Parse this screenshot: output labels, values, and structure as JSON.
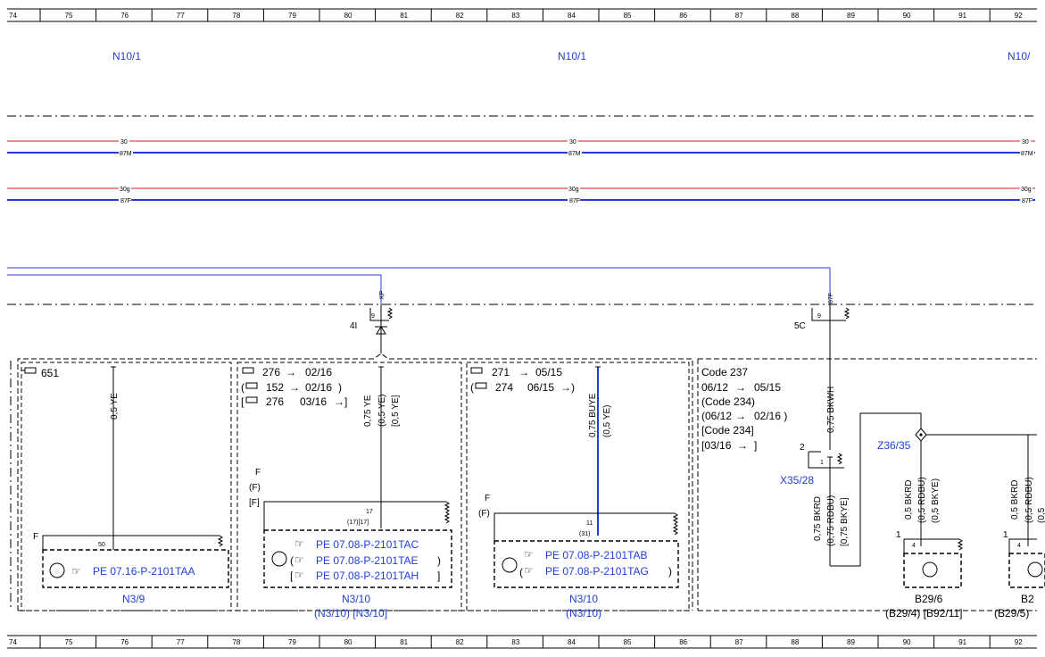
{
  "ruler": {
    "columns": [
      "74",
      "75",
      "76",
      "77",
      "78",
      "79",
      "80",
      "81",
      "82",
      "83",
      "84",
      "85",
      "86",
      "87",
      "88",
      "89",
      "90",
      "91",
      "92"
    ]
  },
  "modules": {
    "left": "N10/1",
    "middle": "N10/1",
    "right": "N10/"
  },
  "bus_lines": {
    "l30": "30",
    "l87m": "87M",
    "l30g": "30g",
    "l87f": "87F",
    "color_red": "#d02020",
    "color_blue": "#1f3fd8"
  },
  "fuse_left": {
    "conn": "9",
    "tag": "KP",
    "ref": "4I"
  },
  "fuse_right": {
    "conn": "9",
    "tag": "87F",
    "ref": "5C"
  },
  "block_n39": {
    "variant": "651",
    "wire": "0,5 YE",
    "relay": "F",
    "pin": "50",
    "doc": "PE 07.16-P-2101TAA",
    "label": "N3/9"
  },
  "block_n310a": {
    "v1_code": "276",
    "v1_date": "02/16",
    "v2_code": "152",
    "v2_date": "02/16",
    "v3_code": "276",
    "v3_date": "03/16",
    "wire1": "0,75 YE",
    "wire2": "(0,5 YE)",
    "wire3": "[0,5 YE]",
    "f1": "F",
    "f2": "(F)",
    "f3": "[F]",
    "pin1": "17",
    "pin2": "(17)[17]",
    "doc1": "PE 07.08-P-2101TAC",
    "doc2": "PE 07.08-P-2101TAE",
    "doc3": "PE 07.08-P-2101TAH",
    "label": "N3/10",
    "sublabel": "(N3/10)  [N3/10]"
  },
  "block_n310b": {
    "v1_code": "271",
    "v1_date": "05/15",
    "v2_code": "274",
    "v2_date": "06/15",
    "wire1": "0,75 BUYE",
    "wire2": "(0,5 YE)",
    "f1": "F",
    "f2": "(F)",
    "pin1": "11",
    "pin2": "(31)",
    "doc1": "PE 07.08-P-2101TAB",
    "doc2": "PE 07.08-P-2101TAG",
    "label": "N3/10",
    "sublabel": "(N3/10)"
  },
  "block_code": {
    "line1": "Code 237",
    "line2": "06/12",
    "line2b": "05/15",
    "line3": "(Code 234)",
    "line4": "(06/12",
    "line4b": "02/16 )",
    "line5": "[Code 234]",
    "line6": "[03/16",
    "line6b": "]"
  },
  "right_side": {
    "wire_main": "0,75 BKWH",
    "x35_pin_a": "2",
    "x35_pin_b": "1",
    "x35_label": "X35/28",
    "wire_left1": "0,75 BKRD",
    "wire_left2": "(0,75 RDBU)",
    "wire_left3": "[0,75 BKYE]",
    "z36_label": "Z36/35",
    "b29_wire1": "0,5 BKRD",
    "b29_wire2": "(0,5 RDBU)",
    "b29_wire3": "(0,5 BKYE)",
    "b29_pin_out": "1",
    "b29_pin_in": "4",
    "b29_label": "B29/6",
    "b29_sub": "(B29/4) [B92/11]",
    "b29b_wire1": "0,5 BKRD",
    "b29b_wire2": "(0,5 RDBU)",
    "b29b_wire3": "(0,5",
    "b29b_pin_out": "1",
    "b29b_pin_in": "4",
    "b29b_label": "B2",
    "b29b_sub": "(B29/5)"
  }
}
